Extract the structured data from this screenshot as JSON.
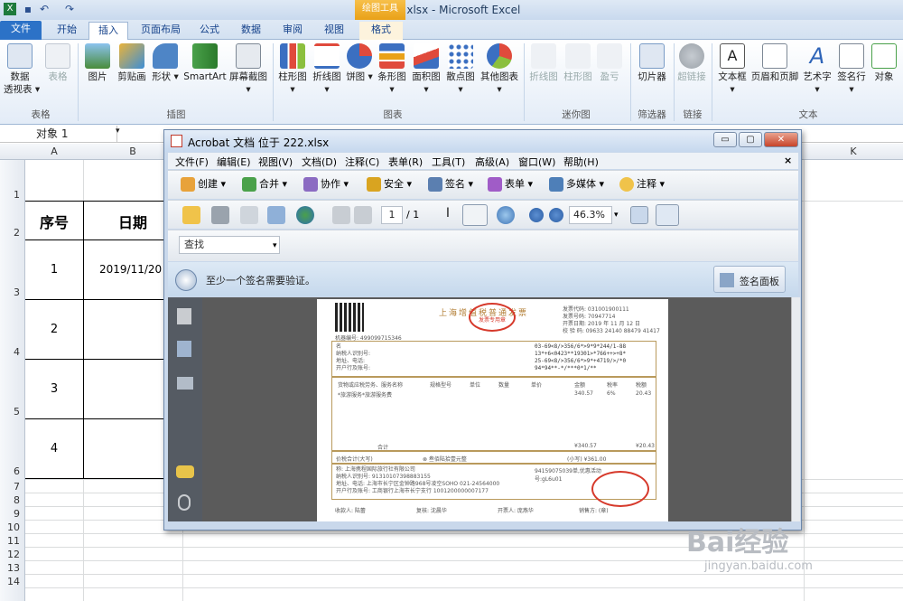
{
  "excel": {
    "window_title": "222.xlsx - Microsoft Excel",
    "contextual_tools": "绘图工具",
    "tabs": [
      "文件",
      "开始",
      "插入",
      "页面布局",
      "公式",
      "数据",
      "审阅",
      "视图",
      "格式"
    ],
    "ribbon": {
      "buttons": [
        {
          "label": "数据\n透视表 ▾"
        },
        {
          "label": "表格",
          "disabled": true
        },
        {
          "label": "图片"
        },
        {
          "label": "剪贴画"
        },
        {
          "label": "形状 ▾"
        },
        {
          "label": "SmartArt"
        },
        {
          "label": "屏幕截图 ▾"
        },
        {
          "label": "柱形图 ▾"
        },
        {
          "label": "折线图 ▾"
        },
        {
          "label": "饼图 ▾"
        },
        {
          "label": "条形图 ▾"
        },
        {
          "label": "面积图 ▾"
        },
        {
          "label": "散点图 ▾"
        },
        {
          "label": "其他图表 ▾"
        },
        {
          "label": "折线图",
          "disabled": true
        },
        {
          "label": "柱形图",
          "disabled": true
        },
        {
          "label": "盈亏",
          "disabled": true
        },
        {
          "label": "切片器"
        },
        {
          "label": "超链接",
          "disabled": true
        },
        {
          "label": "文本框 ▾"
        },
        {
          "label": "页眉和页脚"
        },
        {
          "label": "艺术字 ▾"
        },
        {
          "label": "签名行 ▾"
        },
        {
          "label": "对象"
        }
      ],
      "groups": [
        "表格",
        "插图",
        "图表",
        "迷你图",
        "筛选器",
        "链接",
        "文本"
      ]
    },
    "name_box": "对象 1",
    "columns": [
      "A",
      "B",
      "K"
    ],
    "rows": [
      "1",
      "2",
      "3",
      "4",
      "5",
      "6",
      "7",
      "8",
      "9",
      "10",
      "11",
      "12",
      "13",
      "14"
    ],
    "table": {
      "headers": [
        "序号",
        "日期"
      ],
      "rows": [
        [
          "1",
          "2019/11/20"
        ],
        [
          "2",
          ""
        ],
        [
          "3",
          ""
        ],
        [
          "4",
          ""
        ]
      ]
    }
  },
  "acrobat": {
    "title": "Acrobat 文档 位于 222.xlsx",
    "window_buttons": [
      "▭",
      "▢",
      "✕"
    ],
    "menu": [
      "文件(F)",
      "编辑(E)",
      "视图(V)",
      "文档(D)",
      "注释(C)",
      "表单(R)",
      "工具(T)",
      "高级(A)",
      "窗口(W)",
      "帮助(H)"
    ],
    "menu_close": "×",
    "toolbar1": [
      "创建 ▾",
      "合并 ▾",
      "协作 ▾",
      "安全 ▾",
      "签名 ▾",
      "表单 ▾",
      "多媒体 ▾",
      "注释 ▾"
    ],
    "page_current": "1",
    "page_total": "/ 1",
    "zoom": "46.3%",
    "find_placeholder": "查找",
    "signature_message": "至少一个签名需要验证。",
    "signature_panel_button": "签名面板"
  },
  "invoice": {
    "title": "上海增值税普通发票",
    "seal_text": "发票专用章",
    "code_lines": [
      "发票代码: 031001900111",
      "发票号码: 70947714",
      "开票日期: 2019 年 11 月 12 日",
      "校 验 码: 09633 24140 88479 41417"
    ],
    "machine_no": "机器编号: 499099715346",
    "buyer_labels": [
      "名",
      "纳税人识别号:",
      "地址、电话:",
      "开户行及账号:"
    ],
    "cipher_lines": [
      "03-69<8/>356/6*>9*9*244/1-88",
      "13*+6<0423**19301>*766++>+8*",
      "25-69<8/>356/6*>9*+4719/>/*0",
      "94*94**-*/***0*1/**"
    ],
    "item_headers": [
      "货物或应税劳务、服务名称",
      "规格型号",
      "单位",
      "数量",
      "单价",
      "金额",
      "税率",
      "税额"
    ],
    "item_row": [
      "*旅游服务*旅游服务费",
      "",
      "",
      "",
      "",
      "340.57",
      "6%",
      "20.43"
    ],
    "total_label": "合计",
    "total_amount": "¥340.57",
    "total_tax": "¥20.43",
    "sum_label": "价税合计(大写)",
    "sum_upper": "⊗ 叁佰陆拾壹元整",
    "sum_small": "(小写) ¥361.00",
    "seller_labels": [
      "称: 上海携程国际旅行社有限公司",
      "纳税人识别号: 91310107398883155",
      "地址、电话: 上海市长宁区金钟路968号凌空SOHO 021-24564000",
      "开户行及账号: 工商银行上海市长宁支行 1001200000007177"
    ],
    "remark": "94159075039单,优惠活动号:gL6u01",
    "footer": [
      "收款人: 陆蕾",
      "复核: 沈晨华",
      "开票人: 庞燕华",
      "销售方: (章)"
    ]
  },
  "watermark": {
    "main": "Bai经验",
    "sub": "jingyan.baidu.com"
  }
}
